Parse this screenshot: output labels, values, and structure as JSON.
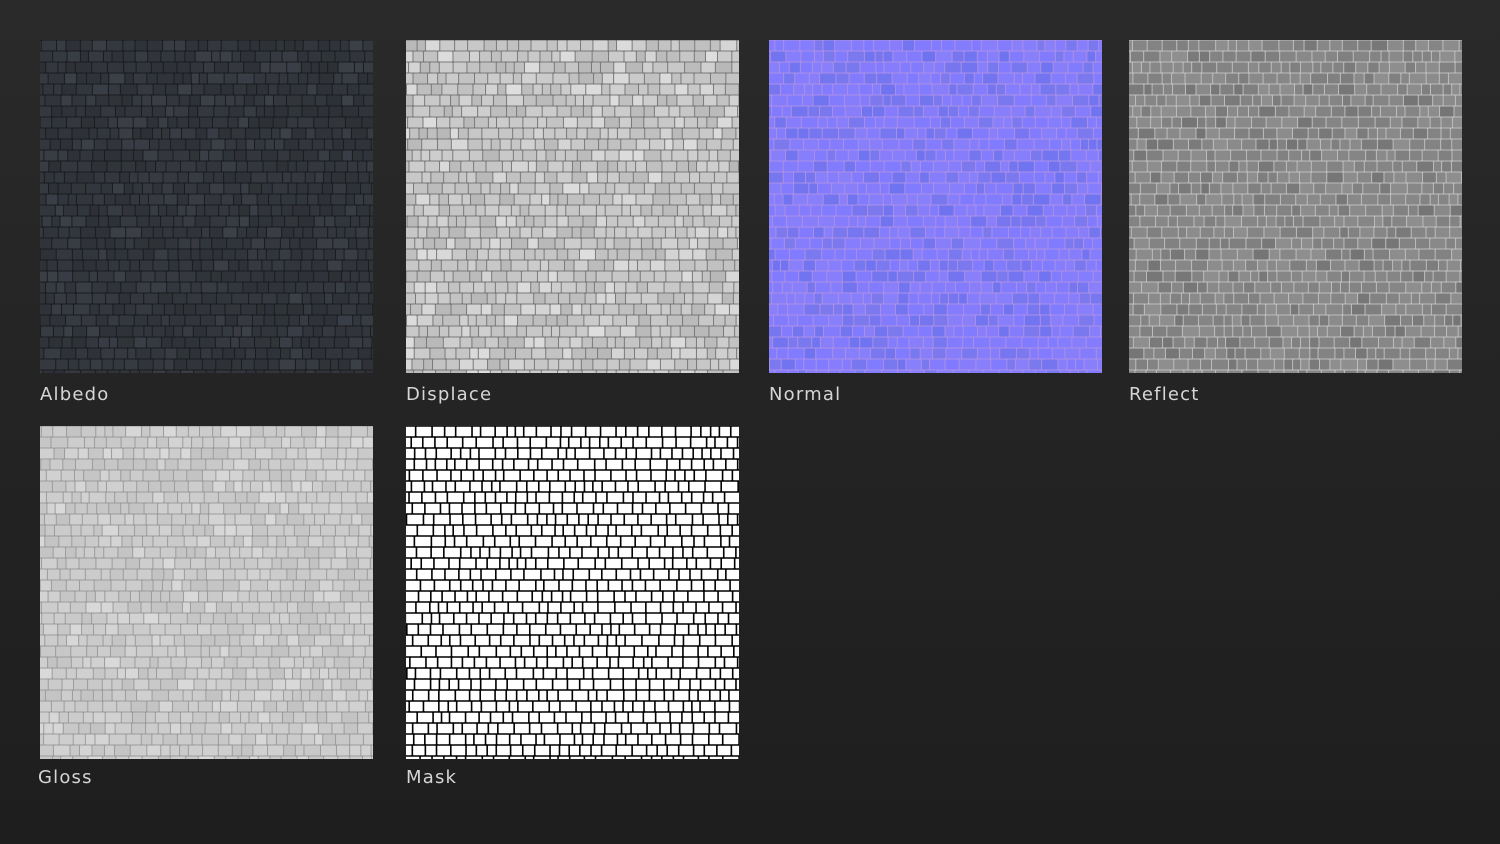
{
  "maps": [
    {
      "id": "albedo",
      "label": "Albedo",
      "base": "#2b2e33",
      "block": "#34383e",
      "grout": "#1a1c20",
      "alt": "#3c4047"
    },
    {
      "id": "displace",
      "label": "Displace",
      "base": "#b9b9b9",
      "block": "#cdcdcd",
      "grout": "#7a7a7a",
      "alt": "#dedede"
    },
    {
      "id": "normal",
      "label": "Normal",
      "base": "#7b76f5",
      "block": "#7f7aff",
      "grout": "#a98fe8",
      "alt": "#6f73f0"
    },
    {
      "id": "reflect",
      "label": "Reflect",
      "base": "#7c7c7c",
      "block": "#808080",
      "grout": "#bdbdbd",
      "alt": "#747474"
    },
    {
      "id": "gloss",
      "label": "Gloss",
      "base": "#c8c8c8",
      "block": "#d0d0d0",
      "grout": "#9c9c9c",
      "alt": "#dadada"
    },
    {
      "id": "mask",
      "label": "Mask",
      "base": "#ffffff",
      "block": "#ffffff",
      "grout": "#000000",
      "alt": "#ffffff"
    }
  ]
}
